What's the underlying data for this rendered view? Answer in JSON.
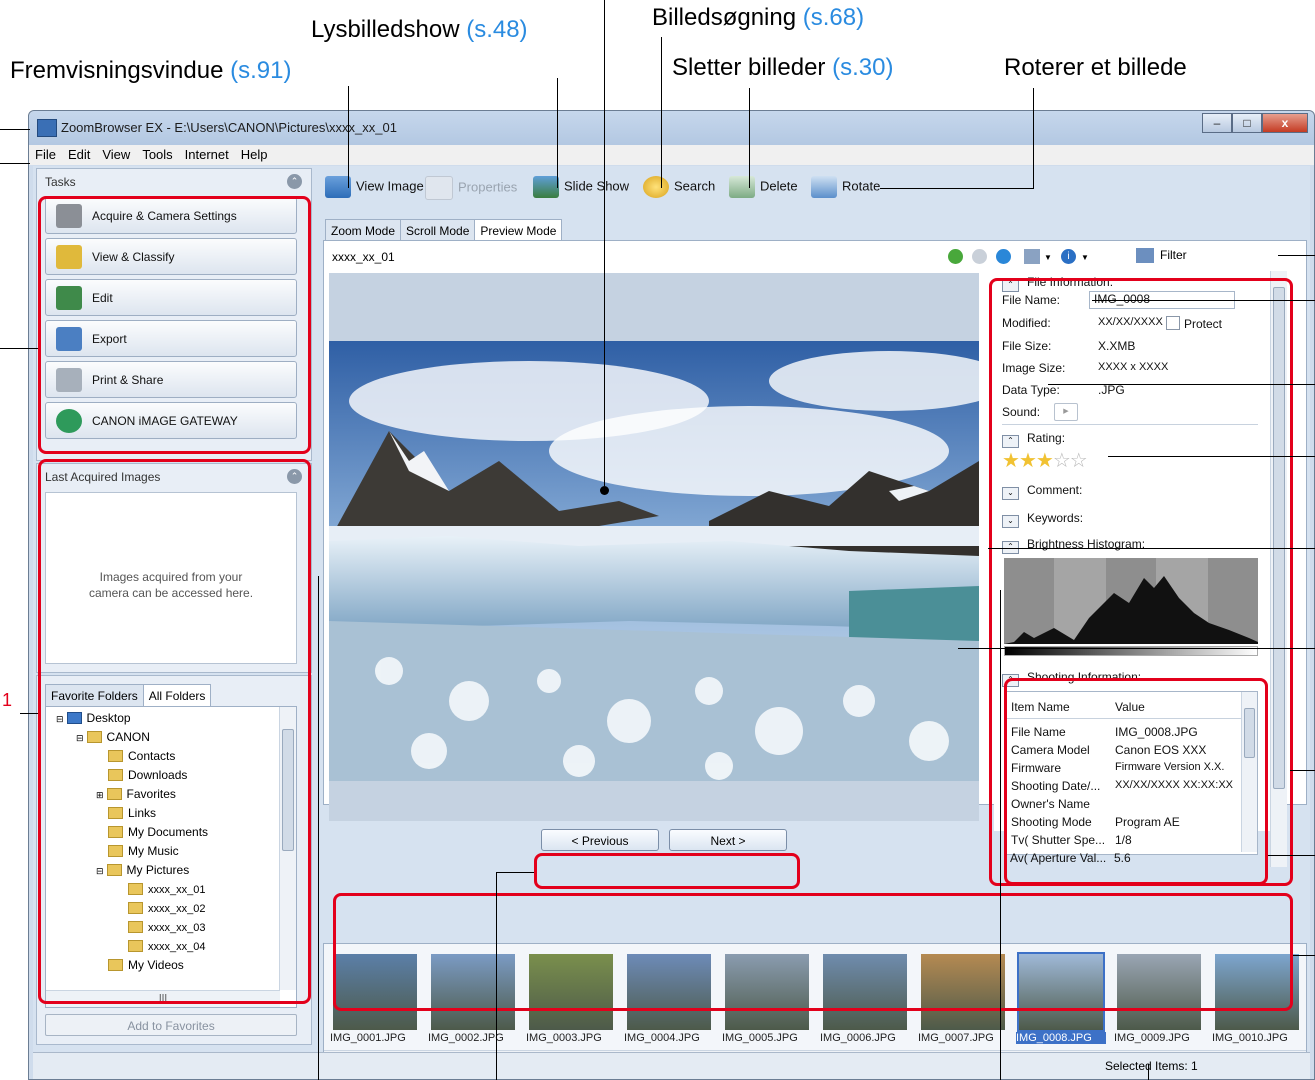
{
  "callouts": {
    "lysbilledshow": "Lysbilledshow",
    "lysbilledshow_ref": "(s.48)",
    "billedsogning": "Billedsøgning",
    "billedsogning_ref": "(s.68)",
    "fremvisning": "Fremvisningsvindue",
    "fremvisning_ref": "(s.91)",
    "sletter": "Sletter billeder",
    "sletter_ref": "(s.30)",
    "roterer": "Roterer et billede",
    "marker_1": "1"
  },
  "window": {
    "title": "ZoomBrowser EX  -  E:\\Users\\CANON\\Pictures\\xxxx_xx_01",
    "minimize": "–",
    "maximize": "□",
    "close": "x"
  },
  "menu": [
    "File",
    "Edit",
    "View",
    "Tools",
    "Internet",
    "Help"
  ],
  "tasks": {
    "header": "Tasks",
    "items": [
      {
        "label": "Acquire & Camera Settings",
        "icon": "camera-icon"
      },
      {
        "label": "View & Classify",
        "icon": "binder-icon"
      },
      {
        "label": "Edit",
        "icon": "edit-icon"
      },
      {
        "label": "Export",
        "icon": "export-icon"
      },
      {
        "label": "Print & Share",
        "icon": "printer-icon"
      },
      {
        "label": "CANON iMAGE GATEWAY",
        "icon": "globe-icon"
      }
    ]
  },
  "last_acquired": {
    "header": "Last Acquired Images",
    "message_1": "Images acquired from your",
    "message_2": "camera can be accessed here."
  },
  "folders": {
    "tab_favorite": "Favorite Folders",
    "tab_all": "All Folders",
    "tree": [
      {
        "label": "Desktop",
        "level": 0
      },
      {
        "label": "CANON",
        "level": 1
      },
      {
        "label": "Contacts",
        "level": 2
      },
      {
        "label": "Downloads",
        "level": 2
      },
      {
        "label": "Favorites",
        "level": 2
      },
      {
        "label": "Links",
        "level": 2
      },
      {
        "label": "My Documents",
        "level": 2
      },
      {
        "label": "My Music",
        "level": 2
      },
      {
        "label": "My Pictures",
        "level": 2
      },
      {
        "label": "xxxx_xx_01",
        "level": 3
      },
      {
        "label": "xxxx_xx_02",
        "level": 3
      },
      {
        "label": "xxxx_xx_03",
        "level": 3
      },
      {
        "label": "xxxx_xx_04",
        "level": 3
      },
      {
        "label": "My Videos",
        "level": 2
      }
    ],
    "add_button": "Add to Favorites",
    "hscroll": "III"
  },
  "toolbar": {
    "view_image": "View Image",
    "properties": "Properties",
    "slideshow": "Slide Show",
    "search": "Search",
    "delete": "Delete",
    "rotate": "Rotate"
  },
  "mode_tabs": [
    "Zoom Mode",
    "Scroll Mode",
    "Preview Mode"
  ],
  "preview": {
    "folder_name": "xxxx_xx_01",
    "filter": "Filter",
    "prev": "< Previous",
    "next": "Next >"
  },
  "file_info": {
    "header": "File Information:",
    "file_name_label": "File Name:",
    "file_name": "IMG_0008",
    "modified_label": "Modified:",
    "modified": "XX/XX/XXXX",
    "protect": "Protect",
    "file_size_label": "File Size:",
    "file_size": "X.XMB",
    "image_size_label": "Image Size:",
    "image_size": "XXXX x XXXX",
    "data_type_label": "Data Type:",
    "data_type": ".JPG",
    "sound_label": "Sound:",
    "rating_header": "Rating:",
    "rating": 3,
    "rating_max": 5,
    "comment_header": "Comment:",
    "keywords_header": "Keywords:",
    "histogram_header": "Brightness Histogram:",
    "shooting_header": "Shooting Information:"
  },
  "shooting": {
    "col_item": "Item Name",
    "col_value": "Value",
    "rows": [
      [
        "File Name",
        "IMG_0008.JPG"
      ],
      [
        "Camera Model",
        "Canon EOS XXX"
      ],
      [
        "Firmware",
        "Firmware Version X.X."
      ],
      [
        "Shooting Date/...",
        "XX/XX/XXXX XX:XX:XX"
      ],
      [
        "Owner's Name",
        ""
      ],
      [
        "Shooting Mode",
        "Program AE"
      ],
      [
        "Tv( Shutter Spe...",
        "1/8"
      ],
      [
        "Av( Aperture Val...",
        "5.6"
      ]
    ]
  },
  "thumbnails": [
    "IMG_0001.JPG",
    "IMG_0002.JPG",
    "IMG_0003.JPG",
    "IMG_0004.JPG",
    "IMG_0005.JPG",
    "IMG_0006.JPG",
    "IMG_0007.JPG",
    "IMG_0008.JPG",
    "IMG_0009.JPG",
    "IMG_0010.JPG"
  ],
  "status": {
    "selected": "Selected Items: 1"
  },
  "colors": {
    "callout_ref": "#2a8be0",
    "highlight_red": "#e3001b",
    "selected_thumb": "#3d71c7"
  }
}
